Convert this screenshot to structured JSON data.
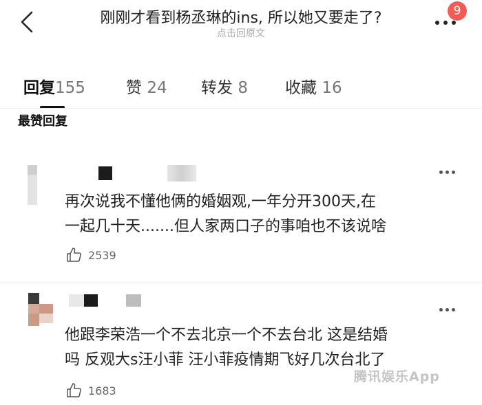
{
  "header": {
    "title": "刚刚才看到杨丞琳的ins, 所以她又要走了?",
    "subtitle": "点击回原文",
    "notification_count": "9"
  },
  "tabs": [
    {
      "label": "回复",
      "count": "155",
      "active": true
    },
    {
      "label": "赞",
      "count": "24",
      "active": false
    },
    {
      "label": "转发",
      "count": "8",
      "active": false
    },
    {
      "label": "收藏",
      "count": "16",
      "active": false
    }
  ],
  "section_title": "最赞回复",
  "comments": [
    {
      "lines": [
        "再次说我不懂他俩的婚姻观,一年分开300天,在",
        "一起几十天.......但人家两口子的事咱也不该说啥"
      ],
      "likes": "2539"
    },
    {
      "lines": [
        "他跟李荣浩一个不去北京一个不去台北 这是结婚",
        "吗 反观大s汪小菲 汪小菲疫情期飞好几次台北了"
      ],
      "likes": "1683"
    }
  ],
  "watermark": "腾讯娱乐App",
  "colors": {
    "badge": "#f25c54",
    "text": "#222222",
    "muted": "#777777"
  }
}
